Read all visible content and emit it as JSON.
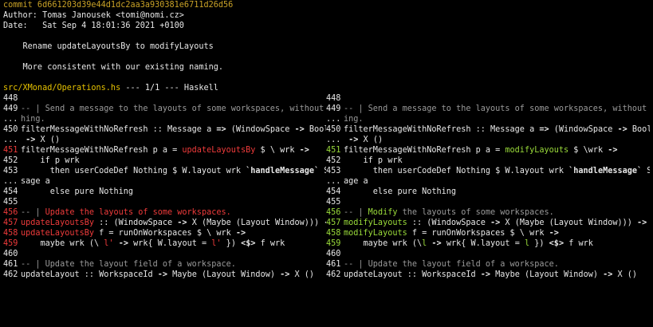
{
  "header": {
    "commit": "commit 6d661203d39e44d1dc2aa3a930381e6711d26d56",
    "author": "Author: Tomas Janousek <tomi@nomi.cz>",
    "date": "Date:   Sat Sep 4 18:01:36 2021 +0100",
    "subject": "    Rename updateLayoutsBy to modifyLayouts",
    "body": "    More consistent with our existing naming."
  },
  "file_header": {
    "path": "src/XMonad/Operations.hs",
    "info": " --- 1/1 --- Haskell"
  },
  "left": [
    {
      "ln": "448",
      "segs": []
    },
    {
      "ln": "449",
      "segs": [
        {
          "t": "-- | Send a message to the layouts of some workspaces, without refres",
          "c": "t-com"
        }
      ]
    },
    {
      "ln": "...",
      "segs": [
        {
          "t": "hing.",
          "c": "t-com"
        }
      ]
    },
    {
      "ln": "450",
      "segs": [
        {
          "t": "filterMessageWithNoRefresh :: Message a ",
          "c": ""
        },
        {
          "t": "=>",
          "c": "t-bold"
        },
        {
          "t": " (WindowSpace ",
          "c": ""
        },
        {
          "t": "->",
          "c": "t-bold"
        },
        {
          "t": " Bool) ",
          "c": ""
        },
        {
          "t": "->",
          "c": "t-bold"
        },
        {
          "t": " a",
          "c": ""
        }
      ]
    },
    {
      "ln": "...",
      "segs": [
        {
          "t": " ",
          "c": ""
        },
        {
          "t": "->",
          "c": "t-bold"
        },
        {
          "t": " X ()",
          "c": ""
        }
      ]
    },
    {
      "ln": "451",
      "lc": "ln-red",
      "segs": [
        {
          "t": "filterMessageWithNoRefresh p a = ",
          "c": ""
        },
        {
          "t": "updateLayoutsBy",
          "c": "t-red"
        },
        {
          "t": " $ \\ wrk ",
          "c": ""
        },
        {
          "t": "->",
          "c": "t-bold"
        }
      ]
    },
    {
      "ln": "452",
      "segs": [
        {
          "t": "    if p wrk",
          "c": ""
        }
      ]
    },
    {
      "ln": "453",
      "segs": [
        {
          "t": "      then userCodeDef Nothing $ W.layout wrk ",
          "c": ""
        },
        {
          "t": "`handleMessage`",
          "c": "t-bold"
        },
        {
          "t": " SomeMes",
          "c": ""
        }
      ]
    },
    {
      "ln": "...",
      "segs": [
        {
          "t": "sage a",
          "c": ""
        }
      ]
    },
    {
      "ln": "454",
      "segs": [
        {
          "t": "      else pure Nothing",
          "c": ""
        }
      ]
    },
    {
      "ln": "455",
      "segs": []
    },
    {
      "ln": "456",
      "lc": "ln-red",
      "segs": [
        {
          "t": "-- | ",
          "c": "t-com"
        },
        {
          "t": "Update the layouts of some workspaces.",
          "c": "t-red"
        }
      ]
    },
    {
      "ln": "457",
      "lc": "ln-red",
      "segs": [
        {
          "t": "updateLayoutsBy",
          "c": "t-red"
        },
        {
          "t": " :: (WindowSpace ",
          "c": ""
        },
        {
          "t": "->",
          "c": "t-bold"
        },
        {
          "t": " X (Maybe (Layout Window))) ",
          "c": ""
        },
        {
          "t": "->",
          "c": "t-bold"
        },
        {
          "t": " X ()",
          "c": ""
        }
      ]
    },
    {
      "ln": "458",
      "lc": "ln-red",
      "segs": [
        {
          "t": "updateLayoutsBy",
          "c": "t-red"
        },
        {
          "t": " f = runOnWorkspaces $ \\ wrk ",
          "c": ""
        },
        {
          "t": "->",
          "c": "t-bold"
        }
      ]
    },
    {
      "ln": "459",
      "lc": "ln-red",
      "segs": [
        {
          "t": "    maybe wrk (\\ ",
          "c": ""
        },
        {
          "t": "l'",
          "c": "t-red"
        },
        {
          "t": " ",
          "c": ""
        },
        {
          "t": "->",
          "c": "t-bold"
        },
        {
          "t": " wrk{ W.layout = ",
          "c": ""
        },
        {
          "t": "l'",
          "c": "t-red"
        },
        {
          "t": " }) ",
          "c": ""
        },
        {
          "t": "<$>",
          "c": "t-bold"
        },
        {
          "t": " f wrk",
          "c": ""
        }
      ]
    },
    {
      "ln": "460",
      "segs": []
    },
    {
      "ln": "461",
      "segs": [
        {
          "t": "-- | Update the layout field of a workspace.",
          "c": "t-com"
        }
      ]
    },
    {
      "ln": "462",
      "segs": [
        {
          "t": "updateLayout :: WorkspaceId ",
          "c": ""
        },
        {
          "t": "->",
          "c": "t-bold"
        },
        {
          "t": " Maybe (Layout Window) ",
          "c": ""
        },
        {
          "t": "->",
          "c": "t-bold"
        },
        {
          "t": " X ()",
          "c": ""
        }
      ]
    }
  ],
  "right": [
    {
      "ln": "448",
      "segs": []
    },
    {
      "ln": "449",
      "segs": [
        {
          "t": "-- | Send a message to the layouts of some workspaces, without refresh",
          "c": "t-com"
        }
      ]
    },
    {
      "ln": "...",
      "segs": [
        {
          "t": "ing.",
          "c": "t-com"
        }
      ]
    },
    {
      "ln": "450",
      "segs": [
        {
          "t": "filterMessageWithNoRefresh :: Message a ",
          "c": ""
        },
        {
          "t": "=>",
          "c": "t-bold"
        },
        {
          "t": " (WindowSpace ",
          "c": ""
        },
        {
          "t": "->",
          "c": "t-bold"
        },
        {
          "t": " Bool) ",
          "c": ""
        },
        {
          "t": "->",
          "c": "t-bold"
        },
        {
          "t": " a",
          "c": ""
        }
      ]
    },
    {
      "ln": "...",
      "segs": [
        {
          "t": " ",
          "c": ""
        },
        {
          "t": "->",
          "c": "t-bold"
        },
        {
          "t": " X ()",
          "c": ""
        }
      ]
    },
    {
      "ln": "451",
      "lc": "ln-green",
      "segs": [
        {
          "t": "filterMessageWithNoRefresh p a = ",
          "c": ""
        },
        {
          "t": "modifyLayouts",
          "c": "t-green"
        },
        {
          "t": " $ \\wrk ",
          "c": ""
        },
        {
          "t": "->",
          "c": "t-bold"
        }
      ]
    },
    {
      "ln": "452",
      "segs": [
        {
          "t": "    if p wrk",
          "c": ""
        }
      ]
    },
    {
      "ln": "453",
      "segs": [
        {
          "t": "      then userCodeDef Nothing $ W.layout wrk ",
          "c": ""
        },
        {
          "t": "`handleMessage`",
          "c": "t-bold"
        },
        {
          "t": " SomeMess",
          "c": ""
        }
      ]
    },
    {
      "ln": "...",
      "segs": [
        {
          "t": "age a",
          "c": ""
        }
      ]
    },
    {
      "ln": "454",
      "segs": [
        {
          "t": "      else pure Nothing",
          "c": ""
        }
      ]
    },
    {
      "ln": "455",
      "segs": []
    },
    {
      "ln": "456",
      "lc": "ln-green",
      "segs": [
        {
          "t": "-- | ",
          "c": "t-com"
        },
        {
          "t": "Modify",
          "c": "t-green"
        },
        {
          "t": " the layouts of some workspaces.",
          "c": "t-com"
        }
      ]
    },
    {
      "ln": "457",
      "lc": "ln-green",
      "segs": [
        {
          "t": "modifyLayouts",
          "c": "t-green"
        },
        {
          "t": " :: (WindowSpace ",
          "c": ""
        },
        {
          "t": "->",
          "c": "t-bold"
        },
        {
          "t": " X (Maybe (Layout Window))) ",
          "c": ""
        },
        {
          "t": "->",
          "c": "t-bold"
        },
        {
          "t": " X ()",
          "c": ""
        }
      ]
    },
    {
      "ln": "458",
      "lc": "ln-green",
      "segs": [
        {
          "t": "modifyLayouts",
          "c": "t-green"
        },
        {
          "t": " f = runOnWorkspaces $ \\ wrk ",
          "c": ""
        },
        {
          "t": "->",
          "c": "t-bold"
        }
      ]
    },
    {
      "ln": "459",
      "lc": "ln-green",
      "segs": [
        {
          "t": "    maybe wrk (\\",
          "c": ""
        },
        {
          "t": "l",
          "c": "t-green"
        },
        {
          "t": " ",
          "c": ""
        },
        {
          "t": "->",
          "c": "t-bold"
        },
        {
          "t": " wrk{ W.layout = ",
          "c": ""
        },
        {
          "t": "l",
          "c": "t-green"
        },
        {
          "t": " }) ",
          "c": ""
        },
        {
          "t": "<$>",
          "c": "t-bold"
        },
        {
          "t": " f wrk",
          "c": ""
        }
      ]
    },
    {
      "ln": "460",
      "segs": []
    },
    {
      "ln": "461",
      "segs": [
        {
          "t": "-- | Update the layout field of a workspace.",
          "c": "t-com"
        }
      ]
    },
    {
      "ln": "462",
      "segs": [
        {
          "t": "updateLayout :: WorkspaceId ",
          "c": ""
        },
        {
          "t": "->",
          "c": "t-bold"
        },
        {
          "t": " Maybe (Layout Window) ",
          "c": ""
        },
        {
          "t": "->",
          "c": "t-bold"
        },
        {
          "t": " X ()",
          "c": ""
        }
      ]
    }
  ]
}
